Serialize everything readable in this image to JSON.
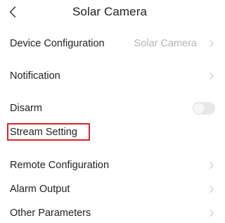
{
  "header": {
    "title": "Solar Camera",
    "back_icon": "chevron-left-icon"
  },
  "rows": [
    {
      "label": "Device Configuration",
      "value": "Solar Camera",
      "control": "chevron"
    },
    {
      "label": "Notification",
      "control": "chevron"
    },
    {
      "label": "Disarm",
      "control": "toggle",
      "toggle_on": false
    },
    {
      "label": "Stream Setting",
      "control": "chevron",
      "highlighted": true
    },
    {
      "label": "Remote Configuration",
      "control": "chevron"
    },
    {
      "label": "Alarm Output",
      "control": "chevron"
    },
    {
      "label": "Other Parameters",
      "control": "chevron"
    }
  ],
  "colors": {
    "highlight": "#d9242b",
    "text": "#222222",
    "secondary_text": "#b5b5b5",
    "chevron": "#c8c8c8"
  }
}
